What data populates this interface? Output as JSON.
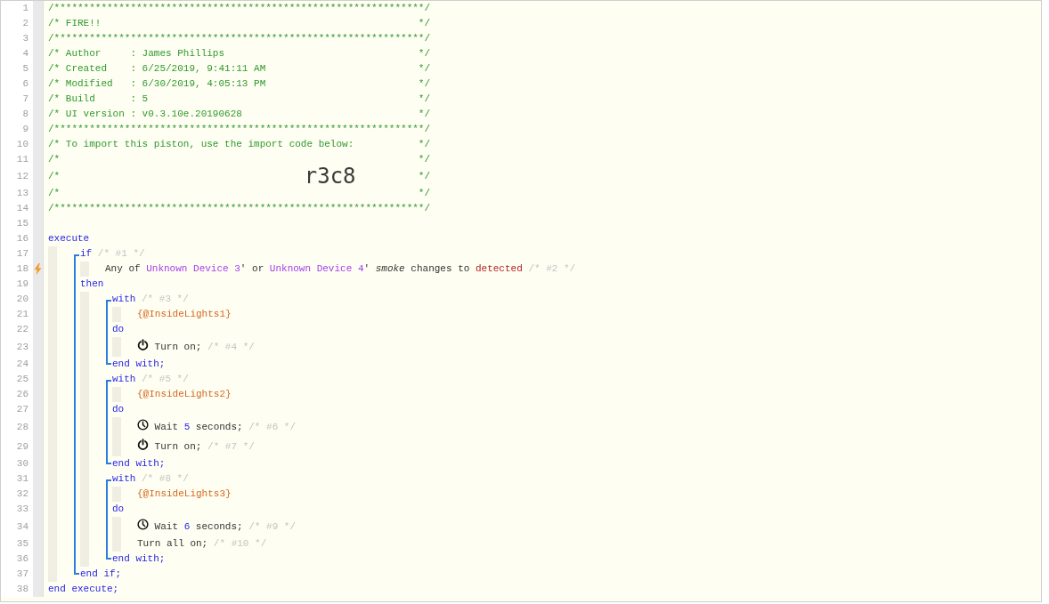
{
  "lines": [
    {
      "number": "1",
      "kind": "banner",
      "text": "/***************************************************************/"
    },
    {
      "number": "2",
      "kind": "banner",
      "text": "/* FIRE!!",
      "end": "*/"
    },
    {
      "number": "3",
      "kind": "banner",
      "text": "/***************************************************************/"
    },
    {
      "number": "4",
      "kind": "banner",
      "text": "/* Author     : James Phillips",
      "end": "*/"
    },
    {
      "number": "5",
      "kind": "banner",
      "text": "/* Created    : 6/25/2019, 9:41:11 AM",
      "end": "*/"
    },
    {
      "number": "6",
      "kind": "banner",
      "text": "/* Modified   : 6/30/2019, 4:05:13 PM",
      "end": "*/"
    },
    {
      "number": "7",
      "kind": "banner",
      "text": "/* Build      : 5",
      "end": "*/"
    },
    {
      "number": "8",
      "kind": "banner",
      "text": "/* UI version : v0.3.10e.20190628",
      "end": "*/"
    },
    {
      "number": "9",
      "kind": "banner",
      "text": "/***************************************************************/"
    },
    {
      "number": "10",
      "kind": "banner",
      "text": "/* To import this piston, use the import code below:",
      "end": "*/"
    },
    {
      "number": "11",
      "kind": "banner",
      "text": "/*",
      "end": "*/"
    },
    {
      "number": "12",
      "kind": "banner",
      "text": "/*",
      "code": "r3c8",
      "end": "*/"
    },
    {
      "number": "13",
      "kind": "banner",
      "text": "/*",
      "end": "*/"
    },
    {
      "number": "14",
      "kind": "banner",
      "text": "/***************************************************************/"
    },
    {
      "number": "15",
      "kind": "code"
    },
    {
      "number": "16",
      "kind": "code",
      "tokens": [
        {
          "kind": "keyword",
          "text": "execute"
        }
      ],
      "children": [
        {
          "kind": "block",
          "lines": [
            {
              "number": "17",
              "kind": "code",
              "tokens": [
                {
                  "kind": "keyword",
                  "text": "if"
                },
                {
                  "kind": "comment",
                  "text": "/* #1 */"
                }
              ],
              "children": [
                {
                  "number": "18",
                  "kind": "code",
                  "trigger": true,
                  "tokens": [
                    {
                      "kind": "plain",
                      "text": "Any of"
                    },
                    {
                      "kind": "device",
                      "text": "Unknown Device 3"
                    },
                    {
                      "kind": "plain",
                      "text": "' or",
                      "attach": true
                    },
                    {
                      "kind": "device",
                      "text": "Unknown Device 4"
                    },
                    {
                      "kind": "plain",
                      "text": "'",
                      "attach": true
                    },
                    {
                      "kind": "italic",
                      "text": "smoke"
                    },
                    {
                      "kind": "plain",
                      "text": "changes to"
                    },
                    {
                      "kind": "value",
                      "text": "detected"
                    },
                    {
                      "kind": "comment",
                      "text": "/* #2 */"
                    }
                  ]
                }
              ]
            },
            {
              "number": "19",
              "kind": "code",
              "tokens": [
                {
                  "kind": "keyword",
                  "text": "then"
                }
              ],
              "children": [
                {
                  "kind": "block",
                  "lines": [
                    {
                      "number": "20",
                      "kind": "code",
                      "tokens": [
                        {
                          "kind": "keyword",
                          "text": "with"
                        },
                        {
                          "kind": "comment",
                          "text": "/* #3 */"
                        }
                      ],
                      "children": [
                        {
                          "number": "21",
                          "kind": "code",
                          "tokens": [
                            {
                              "kind": "variable",
                              "text": "{@InsideLights1}"
                            }
                          ]
                        }
                      ]
                    },
                    {
                      "number": "22",
                      "kind": "code",
                      "tokens": [
                        {
                          "kind": "keyword",
                          "text": "do"
                        }
                      ],
                      "children": [
                        {
                          "number": "23",
                          "kind": "code",
                          "tokens": [
                            {
                              "kind": "power"
                            },
                            {
                              "kind": "plain",
                              "text": "Turn on;"
                            },
                            {
                              "kind": "comment",
                              "text": "/* #4 */"
                            }
                          ]
                        }
                      ]
                    },
                    {
                      "number": "24",
                      "kind": "code",
                      "tokens": [
                        {
                          "kind": "keyword",
                          "text": "end with;"
                        }
                      ]
                    }
                  ]
                },
                {
                  "kind": "block",
                  "lines": [
                    {
                      "number": "25",
                      "kind": "code",
                      "tokens": [
                        {
                          "kind": "keyword",
                          "text": "with"
                        },
                        {
                          "kind": "comment",
                          "text": "/* #5 */"
                        }
                      ],
                      "children": [
                        {
                          "number": "26",
                          "kind": "code",
                          "tokens": [
                            {
                              "kind": "variable",
                              "text": "{@InsideLights2}"
                            }
                          ]
                        }
                      ]
                    },
                    {
                      "number": "27",
                      "kind": "code",
                      "tokens": [
                        {
                          "kind": "keyword",
                          "text": "do"
                        }
                      ],
                      "children": [
                        {
                          "number": "28",
                          "kind": "code",
                          "tokens": [
                            {
                              "kind": "clock"
                            },
                            {
                              "kind": "plain",
                              "text": "Wait"
                            },
                            {
                              "kind": "number",
                              "text": "5"
                            },
                            {
                              "kind": "plain",
                              "text": "seconds;"
                            },
                            {
                              "kind": "comment",
                              "text": "/* #6 */"
                            }
                          ]
                        },
                        {
                          "number": "29",
                          "kind": "code",
                          "tokens": [
                            {
                              "kind": "power"
                            },
                            {
                              "kind": "plain",
                              "text": "Turn on;"
                            },
                            {
                              "kind": "comment",
                              "text": "/* #7 */"
                            }
                          ]
                        }
                      ]
                    },
                    {
                      "number": "30",
                      "kind": "code",
                      "tokens": [
                        {
                          "kind": "keyword",
                          "text": "end with;"
                        }
                      ]
                    }
                  ]
                },
                {
                  "kind": "block",
                  "lines": [
                    {
                      "number": "31",
                      "kind": "code",
                      "tokens": [
                        {
                          "kind": "keyword",
                          "text": "with"
                        },
                        {
                          "kind": "comment",
                          "text": "/* #8 */"
                        }
                      ],
                      "children": [
                        {
                          "number": "32",
                          "kind": "code",
                          "tokens": [
                            {
                              "kind": "variable",
                              "text": "{@InsideLights3}"
                            }
                          ]
                        }
                      ]
                    },
                    {
                      "number": "33",
                      "kind": "code",
                      "tokens": [
                        {
                          "kind": "keyword",
                          "text": "do"
                        }
                      ],
                      "children": [
                        {
                          "number": "34",
                          "kind": "code",
                          "tokens": [
                            {
                              "kind": "clock"
                            },
                            {
                              "kind": "plain",
                              "text": "Wait"
                            },
                            {
                              "kind": "number",
                              "text": "6"
                            },
                            {
                              "kind": "plain",
                              "text": "seconds;"
                            },
                            {
                              "kind": "comment",
                              "text": "/* #9 */"
                            }
                          ]
                        },
                        {
                          "number": "35",
                          "kind": "code",
                          "tokens": [
                            {
                              "kind": "plain",
                              "text": "Turn all on;"
                            },
                            {
                              "kind": "comment",
                              "text": "/* #10 */"
                            }
                          ]
                        }
                      ]
                    },
                    {
                      "number": "36",
                      "kind": "code",
                      "tokens": [
                        {
                          "kind": "keyword",
                          "text": "end with;"
                        }
                      ]
                    }
                  ]
                }
              ]
            },
            {
              "number": "37",
              "kind": "code",
              "tokens": [
                {
                  "kind": "keyword",
                  "text": "end if;"
                }
              ]
            }
          ]
        }
      ]
    },
    {
      "number": "38",
      "kind": "code",
      "tokens": [
        {
          "kind": "keyword",
          "text": "end execute;"
        }
      ]
    }
  ]
}
